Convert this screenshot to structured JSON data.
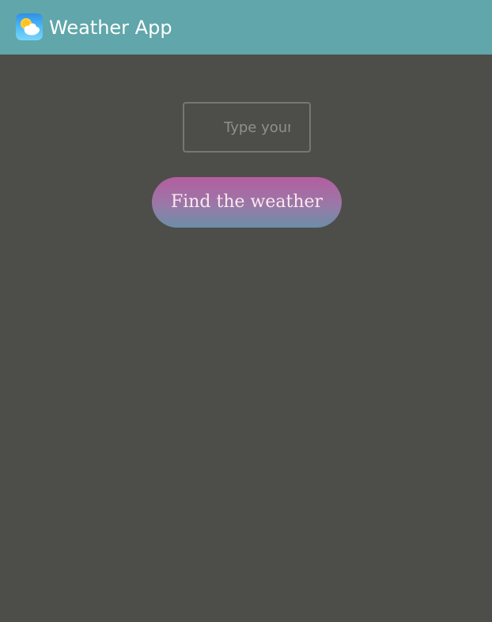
{
  "app": {
    "title": "Weather App",
    "icon": "weather-sun-cloud-icon"
  },
  "search": {
    "placeholder": "Type your city",
    "value": ""
  },
  "actions": {
    "find_label": "Find the weather"
  },
  "colors": {
    "titlebar": "#60a6aa",
    "background": "#4d4d4a",
    "button_gradient_top": "#b45e9f",
    "button_gradient_bottom": "#6b8fa8",
    "button_text": "#fbe7ee"
  }
}
